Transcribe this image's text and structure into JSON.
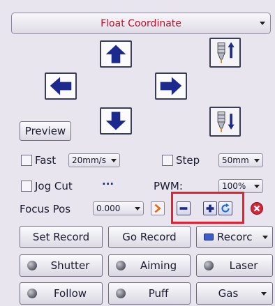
{
  "top_select": {
    "value": "Float Coordinate"
  },
  "preview_label": "Preview",
  "fast": {
    "label": "Fast",
    "speed": "20mm/s"
  },
  "step": {
    "label": "Step",
    "value": "50mm"
  },
  "jog_cut": {
    "label": "Jog Cut",
    "more": "···"
  },
  "pwm": {
    "label": "PWM:",
    "value": "100%"
  },
  "focus": {
    "label": "Focus Pos",
    "value": "0.000"
  },
  "record": {
    "set_label": "Set Record",
    "go_label": "Go Record",
    "select_label": "Recorc"
  },
  "outputs": {
    "shutter": "Shutter",
    "aiming": "Aiming",
    "laser": "Laser",
    "follow": "Follow",
    "puff": "Puff",
    "gas": "Gas"
  },
  "colors": {
    "title_red": "#c0102a",
    "arrow_blue": "#1b2a8c",
    "highlight": "#e8202e"
  }
}
